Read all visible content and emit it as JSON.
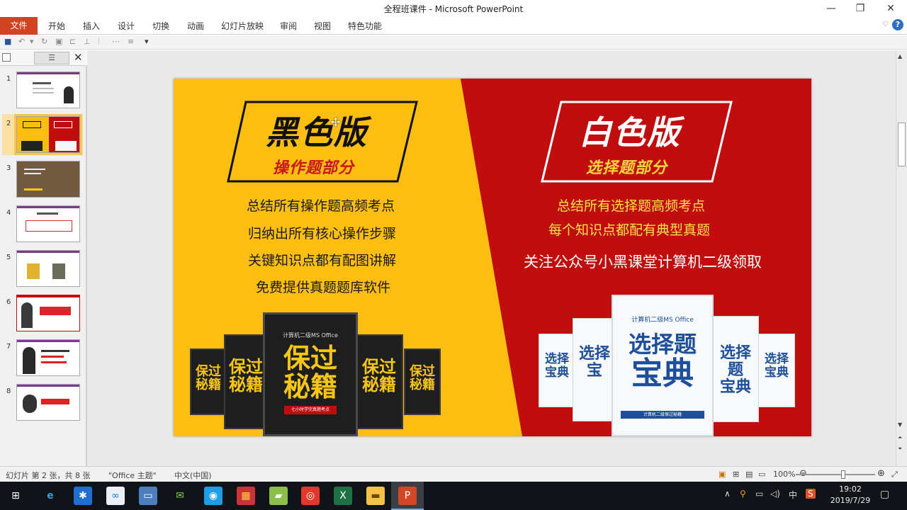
{
  "window": {
    "title": "全程班课件 - Microsoft PowerPoint",
    "minimize_glyph": "—",
    "restore_glyph": "❐",
    "close_glyph": "✕"
  },
  "ribbon": {
    "file_tab": "文件",
    "tabs": [
      "开始",
      "插入",
      "设计",
      "切换",
      "动画",
      "幻灯片放映",
      "审阅",
      "视图",
      "特色功能"
    ],
    "help_glyph": "?",
    "collapse_glyph": "♡"
  },
  "thumbnails": {
    "slide_numbers": [
      "1",
      "2",
      "3",
      "4",
      "5",
      "6",
      "7",
      "8"
    ],
    "selected": "2",
    "close_glyph": "✕"
  },
  "slide": {
    "left_badge_title": "黑色版",
    "left_badge_sub": "操作题部分",
    "right_badge_title": "白色版",
    "right_badge_sub": "选择题部分",
    "left_lines": [
      "总结所有操作题高频考点",
      "归纳出所有核心操作步骤",
      "关键知识点都有配图讲解",
      "免费提供真题题库软件"
    ],
    "right_lines": [
      "总结所有选择题高频考点",
      "每个知识点都配有典型真题"
    ],
    "right_notice": "关注公众号小黑课堂计算机二级领取",
    "black_book": {
      "top": "计算机二级MS Office",
      "title1": "保过",
      "title2": "秘籍",
      "tag": "七小时学完真题考点"
    },
    "white_book": {
      "top": "计算机二级MS Office",
      "title1": "选择题",
      "title2": "宝典",
      "bar": "计算机二级保过秘籍"
    },
    "colors": {
      "left_bg": "#fcbe10",
      "right_bg": "#c00d0d"
    }
  },
  "status": {
    "slide_info": "幻灯片 第 2 张，共 8 张",
    "theme": "\"Office 主题\"",
    "language": "中文(中国)",
    "zoom": "100%"
  },
  "taskbar": {
    "time": "19:02",
    "date": "2019/7/29",
    "ime": "中"
  }
}
